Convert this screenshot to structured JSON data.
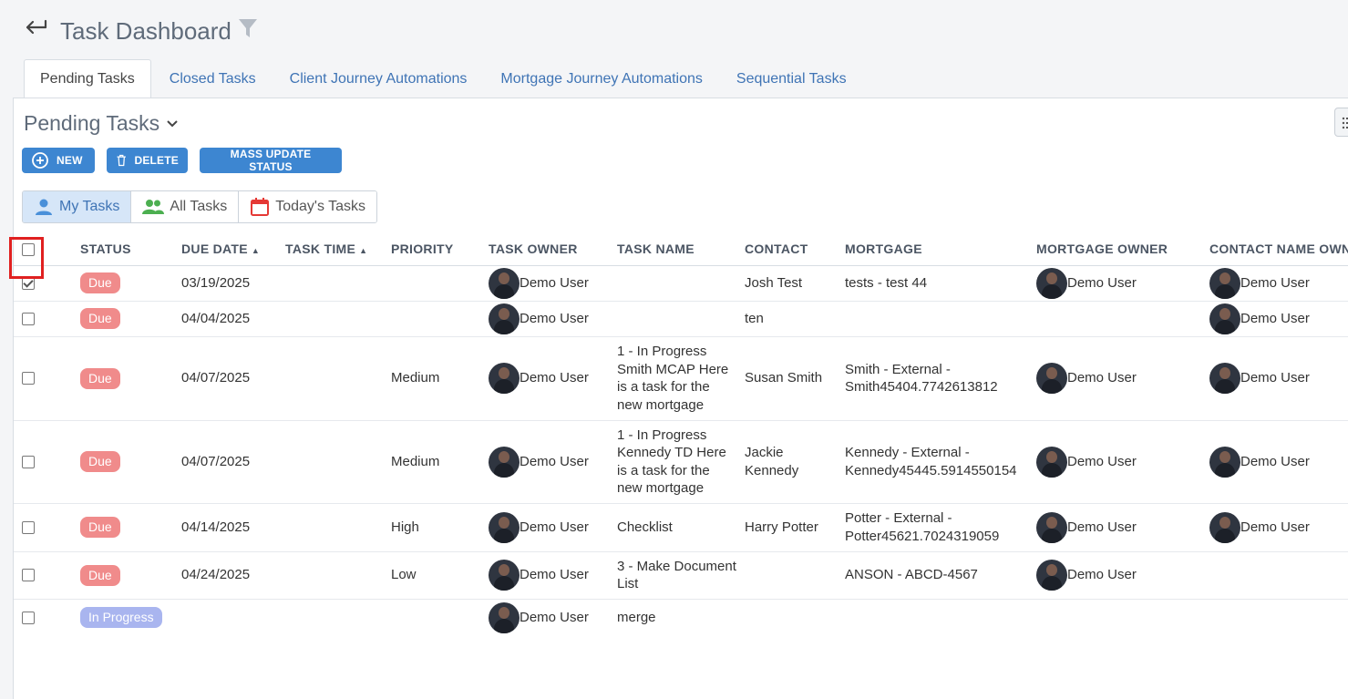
{
  "header": {
    "title": "Task Dashboard"
  },
  "tabs": [
    {
      "label": "Pending Tasks"
    },
    {
      "label": "Closed Tasks"
    },
    {
      "label": "Client Journey Automations"
    },
    {
      "label": "Mortgage Journey Automations"
    },
    {
      "label": "Sequential Tasks"
    }
  ],
  "section": {
    "title": "Pending Tasks"
  },
  "toolbar": {
    "new_label": "NEW",
    "delete_label": "DELETE",
    "mass_update_label": "MASS UPDATE STATUS"
  },
  "views": [
    {
      "label": "My Tasks"
    },
    {
      "label": "All Tasks"
    },
    {
      "label": "Today's Tasks"
    }
  ],
  "colors": {
    "accent": "#3d86d1",
    "due_badge": "#f08b8b",
    "in_progress_badge": "#a9b5ef",
    "highlight": "#e02020"
  },
  "table": {
    "columns": [
      "STATUS",
      "DUE DATE",
      "TASK TIME",
      "PRIORITY",
      "TASK OWNER",
      "TASK NAME",
      "CONTACT",
      "MORTGAGE",
      "MORTGAGE OWNER",
      "CONTACT NAME OWN"
    ],
    "rows": [
      {
        "checked": true,
        "status": "Due",
        "due_date": "03/19/2025",
        "task_time": "",
        "priority": "",
        "task_owner": "Demo User",
        "task_name": "",
        "contact": "Josh Test",
        "mortgage": "tests - test 44",
        "mortgage_owner": "Demo User",
        "contact_owner": "Demo User"
      },
      {
        "checked": false,
        "status": "Due",
        "due_date": "04/04/2025",
        "task_time": "",
        "priority": "",
        "task_owner": "Demo User",
        "task_name": "",
        "contact": "ten",
        "mortgage": "",
        "mortgage_owner": "",
        "contact_owner": "Demo User"
      },
      {
        "checked": false,
        "status": "Due",
        "due_date": "04/07/2025",
        "task_time": "",
        "priority": "Medium",
        "task_owner": "Demo User",
        "task_name": "1 - In Progress Smith MCAP Here is a task for the new mortgage",
        "contact": "Susan Smith",
        "mortgage": "Smith - External - Smith45404.7742613812",
        "mortgage_owner": "Demo User",
        "contact_owner": "Demo User"
      },
      {
        "checked": false,
        "status": "Due",
        "due_date": "04/07/2025",
        "task_time": "",
        "priority": "Medium",
        "task_owner": "Demo User",
        "task_name": "1 - In Progress Kennedy TD Here is a task for the new mortgage",
        "contact": "Jackie Kennedy",
        "mortgage": "Kennedy - External - Kennedy45445.5914550154",
        "mortgage_owner": "Demo User",
        "contact_owner": "Demo User"
      },
      {
        "checked": false,
        "status": "Due",
        "due_date": "04/14/2025",
        "task_time": "",
        "priority": "High",
        "task_owner": "Demo User",
        "task_name": "Checklist",
        "contact": "Harry Potter",
        "mortgage": "Potter - External - Potter45621.7024319059",
        "mortgage_owner": "Demo User",
        "contact_owner": "Demo User"
      },
      {
        "checked": false,
        "status": "Due",
        "due_date": "04/24/2025",
        "task_time": "",
        "priority": "Low",
        "task_owner": "Demo User",
        "task_name": "3 - Make Document List",
        "contact": "",
        "mortgage": "ANSON - ABCD-4567",
        "mortgage_owner": "Demo User",
        "contact_owner": ""
      },
      {
        "checked": false,
        "status": "In Progress",
        "due_date": "",
        "task_time": "",
        "priority": "",
        "task_owner": "Demo User",
        "task_name": "merge",
        "contact": "",
        "mortgage": "",
        "mortgage_owner": "",
        "contact_owner": ""
      }
    ]
  }
}
